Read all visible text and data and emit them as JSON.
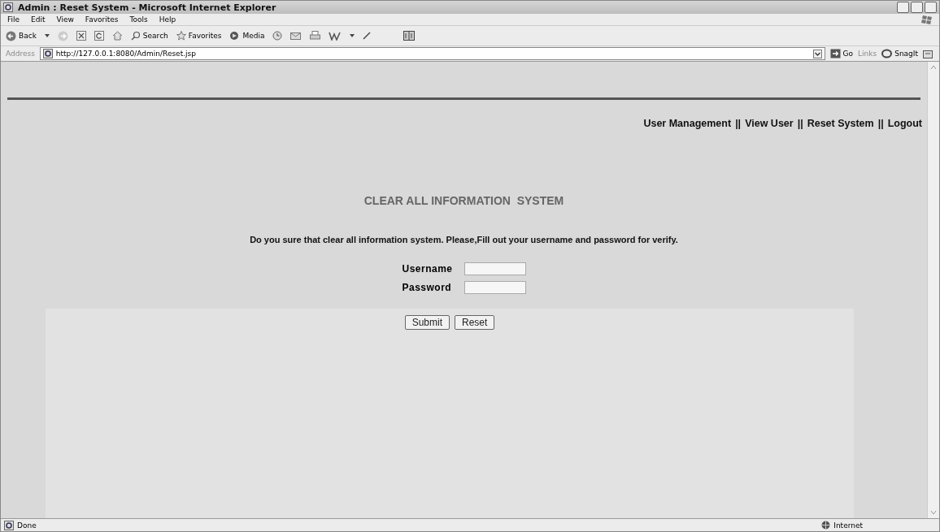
{
  "window": {
    "title": "Admin : Reset System - Microsoft Internet Explorer"
  },
  "menu": [
    "File",
    "Edit",
    "View",
    "Favorites",
    "Tools",
    "Help"
  ],
  "toolbar": {
    "back": "Back",
    "search": "Search",
    "favorites": "Favorites",
    "media": "Media"
  },
  "address_bar": {
    "label": "Address",
    "url": "http://127.0.0.1:8080/Admin/Reset.jsp",
    "go": "Go",
    "links": "Links",
    "snagit": "SnagIt"
  },
  "nav": [
    {
      "label": "User Management"
    },
    {
      "label": "View User"
    },
    {
      "label": "Reset System"
    },
    {
      "label": "Logout"
    }
  ],
  "nav_separator": "||",
  "heading": "CLEAR ALL INFORMATION  SYSTEM",
  "message": "Do you sure that clear all information system. Please,Fill out your username and password for verify.",
  "fields": [
    {
      "label": "Username"
    },
    {
      "label": "Password"
    }
  ],
  "buttons": [
    "Submit",
    "Reset"
  ],
  "status_bar": {
    "status": "Done",
    "zone": "Internet"
  }
}
